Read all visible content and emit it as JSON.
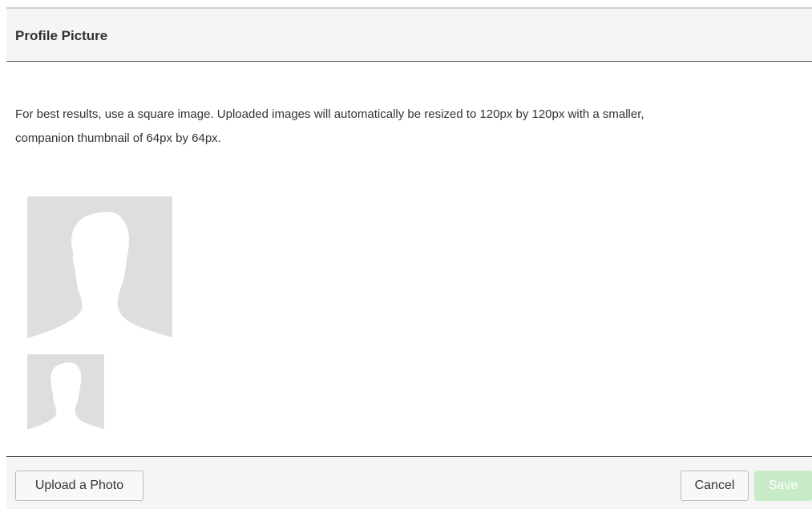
{
  "header": {
    "title": "Profile Picture"
  },
  "description": {
    "line1": "For best results, use a square image. Uploaded images will automatically be resized to 120px by 120px with a smaller,",
    "line2": "companion thumbnail of 64px by 64px."
  },
  "avatars": {
    "large_icon": "person-silhouette-icon",
    "small_icon": "person-silhouette-icon"
  },
  "footer": {
    "upload_label": "Upload a Photo",
    "cancel_label": "Cancel",
    "save_label": "Save",
    "save_disabled": true
  },
  "colors": {
    "header_bg": "#f5f5f5",
    "avatar_bg": "#dedede",
    "save_disabled_bg": "#c8ebc8"
  }
}
